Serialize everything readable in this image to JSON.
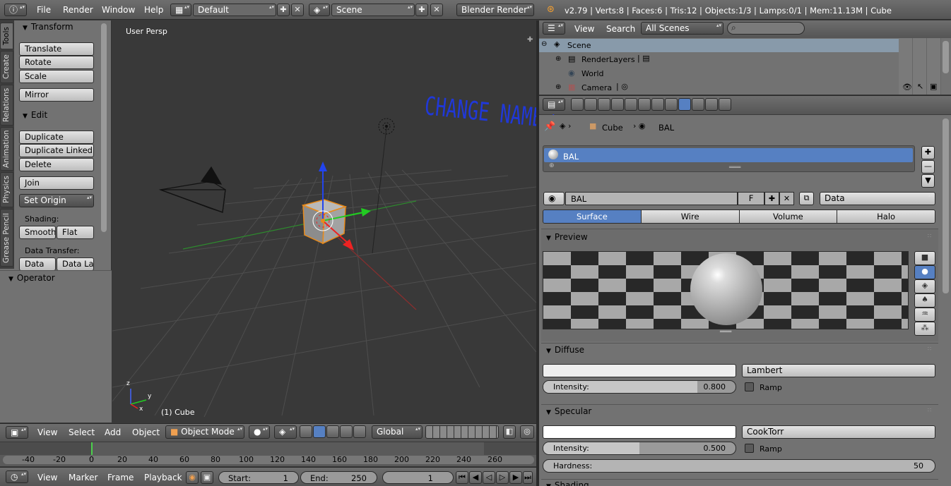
{
  "topbar": {
    "menus": [
      "File",
      "Render",
      "Window",
      "Help"
    ],
    "layout": "Default",
    "scene": "Scene",
    "engine": "Blender Render",
    "stats": "v2.79 | Verts:8 | Faces:6 | Tris:12 | Objects:1/3 | Lamps:0/1 | Mem:11.13M | Cube"
  },
  "tool_tabs": [
    "Tools",
    "Create",
    "Relations",
    "Animation",
    "Physics",
    "Grease Pencil"
  ],
  "tool_shelf": {
    "transform_title": "Transform",
    "transform_buttons": [
      "Translate",
      "Rotate",
      "Scale"
    ],
    "mirror": "Mirror",
    "edit_title": "Edit",
    "edit_buttons": [
      "Duplicate",
      "Duplicate Linked",
      "Delete"
    ],
    "join": "Join",
    "set_origin": "Set Origin",
    "shading_label": "Shading:",
    "smooth": "Smooth",
    "flat": "Flat",
    "data_transfer_label": "Data Transfer:",
    "data": "Data",
    "data_la": "Data La",
    "operator_title": "Operator"
  },
  "viewport": {
    "view_label": "User Persp",
    "object_label": "(1) Cube",
    "annotation": "CHANGE NAME"
  },
  "viewport_header": {
    "menus": [
      "View",
      "Select",
      "Add",
      "Object"
    ],
    "mode": "Object Mode",
    "orientation": "Global"
  },
  "timeline": {
    "ticks": [
      "-40",
      "-20",
      "0",
      "20",
      "40",
      "60",
      "80",
      "100",
      "120",
      "140",
      "160",
      "180",
      "200",
      "220",
      "240",
      "260"
    ],
    "menus": [
      "View",
      "Marker",
      "Frame",
      "Playback"
    ],
    "start_label": "Start:",
    "start": "1",
    "end_label": "End:",
    "end": "250",
    "current": "1"
  },
  "outliner": {
    "view": "View",
    "search": "Search",
    "filter": "All Scenes",
    "items": [
      "Scene",
      "RenderLayers",
      "World",
      "Camera"
    ]
  },
  "properties": {
    "breadcrumb_object": "Cube",
    "breadcrumb_material": "BAL",
    "slot_name": "BAL",
    "material_name": "BAL",
    "fake_user": "F",
    "link": "Data",
    "tabs": [
      "Surface",
      "Wire",
      "Volume",
      "Halo"
    ],
    "preview_title": "Preview",
    "diffuse_title": "Diffuse",
    "diffuse_shader": "Lambert",
    "diffuse_intensity_label": "Intensity:",
    "diffuse_intensity": "0.800",
    "diffuse_intensity_value": 0.8,
    "ramp": "Ramp",
    "specular_title": "Specular",
    "specular_shader": "CookTorr",
    "specular_intensity_label": "Intensity:",
    "specular_intensity": "0.500",
    "specular_intensity_value": 0.5,
    "hardness_label": "Hardness:",
    "hardness": "50",
    "shading_title": "Shading"
  }
}
